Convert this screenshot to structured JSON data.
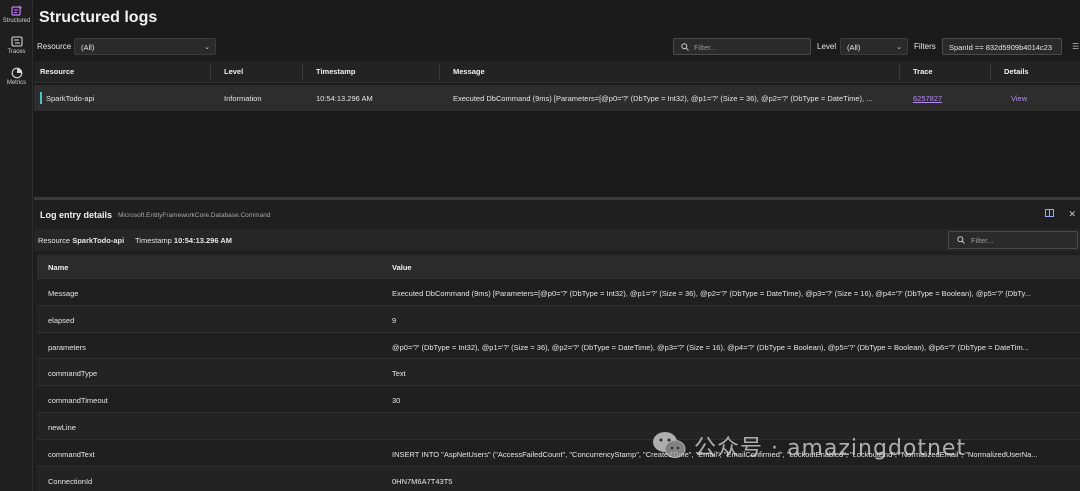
{
  "nav": {
    "items": [
      {
        "label": "Structured",
        "icon": "structured-logs-icon"
      },
      {
        "label": "Traces",
        "icon": "traces-icon"
      },
      {
        "label": "Metrics",
        "icon": "metrics-icon"
      }
    ]
  },
  "page": {
    "title": "Structured logs"
  },
  "toolbar": {
    "resource_label": "Resource",
    "resource_value": "(All)",
    "search_placeholder": "Filter...",
    "level_label": "Level",
    "level_value": "(All)",
    "filters_label": "Filters",
    "filter_value": "SpanId == 832d5909b4014c23"
  },
  "grid": {
    "columns": [
      "Resource",
      "Level",
      "Timestamp",
      "Message",
      "Trace",
      "Details"
    ],
    "rows": [
      {
        "resource": "SparkTodo-api",
        "level": "Information",
        "timestamp": "10:54:13.296 AM",
        "message": "Executed DbCommand (9ms) [Parameters=[@p0='?' (DbType = Int32), @p1='?' (Size = 36), @p2='?' (DbType = DateTime), ...",
        "trace": "6257827",
        "details": "View"
      }
    ]
  },
  "details": {
    "title": "Log entry details",
    "category": "Microsoft.EntityFrameworkCore.Database.Command",
    "resource_label": "Resource",
    "resource_value": "SparkTodo-api",
    "timestamp_label": "Timestamp",
    "timestamp_value": "10:54:13.296 AM",
    "search_placeholder": "Filter...",
    "columns": [
      "Name",
      "Value"
    ],
    "rows": [
      {
        "name": "Message",
        "value": "Executed DbCommand (9ms) [Parameters=[@p0='?' (DbType = Int32), @p1='?' (Size = 36), @p2='?' (DbType = DateTime), @p3='?' (Size = 16), @p4='?' (DbType = Boolean), @p5='?' (DbTy..."
      },
      {
        "name": "elapsed",
        "value": "9"
      },
      {
        "name": "parameters",
        "value": "@p0='?' (DbType = Int32), @p1='?' (Size = 36), @p2='?' (DbType = DateTime), @p3='?' (Size = 16), @p4='?' (DbType = Boolean), @p5='?' (DbType = Boolean), @p6='?' (DbType = DateTim..."
      },
      {
        "name": "commandType",
        "value": "Text"
      },
      {
        "name": "commandTimeout",
        "value": "30"
      },
      {
        "name": "newLine",
        "value": ""
      },
      {
        "name": "commandText",
        "value": "INSERT INTO \"AspNetUsers\" (\"AccessFailedCount\", \"ConcurrencyStamp\", \"CreatedTime\", \"Email\", \"EmailConfirmed\", \"LockoutEnabled\", \"LockoutEnd\", \"NormalizedEmail\", \"NormalizedUserNa..."
      },
      {
        "name": "ConnectionId",
        "value": "0HN7M6A7T43T5"
      }
    ]
  },
  "watermark": {
    "text": "公众号 · amazingdotnet"
  },
  "colors": {
    "accent": "#b58af0",
    "resource_bar": "#4cc3c9",
    "background": "#1b1b1b"
  }
}
